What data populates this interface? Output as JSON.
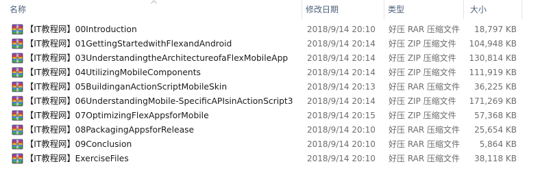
{
  "columns": {
    "name": "名称",
    "date_modified": "修改日期",
    "type": "类型",
    "size": "大小"
  },
  "files": [
    {
      "name": "【IT教程网】00Introduction",
      "date_modified": "2018/9/14 20:10",
      "type": "好压 RAR 压缩文件",
      "size": "18,797 KB",
      "icon": "rar-archive-icon"
    },
    {
      "name": "【IT教程网】01GettingStartedwithFlexandAndroid",
      "date_modified": "2018/9/14 20:14",
      "type": "好压 ZIP 压缩文件",
      "size": "104,948 KB",
      "icon": "zip-archive-icon"
    },
    {
      "name": "【IT教程网】03UnderstandingtheArchitectureofaFlexMobileApp",
      "date_modified": "2018/9/14 20:14",
      "type": "好压 ZIP 压缩文件",
      "size": "130,814 KB",
      "icon": "zip-archive-icon"
    },
    {
      "name": "【IT教程网】04UtilizingMobileComponents",
      "date_modified": "2018/9/14 20:14",
      "type": "好压 ZIP 压缩文件",
      "size": "111,919 KB",
      "icon": "zip-archive-icon"
    },
    {
      "name": "【IT教程网】05BuildinganActionScriptMobileSkin",
      "date_modified": "2018/9/14 20:13",
      "type": "好压 RAR 压缩文件",
      "size": "36,225 KB",
      "icon": "rar-archive-icon"
    },
    {
      "name": "【IT教程网】06UnderstandingMobile-SpecificAPIsinActionScript3",
      "date_modified": "2018/9/14 20:14",
      "type": "好压 ZIP 压缩文件",
      "size": "171,269 KB",
      "icon": "zip-archive-icon"
    },
    {
      "name": "【IT教程网】07OptimizingFlexAppsforMobile",
      "date_modified": "2018/9/14 20:15",
      "type": "好压 ZIP 压缩文件",
      "size": "57,368 KB",
      "icon": "zip-archive-icon"
    },
    {
      "name": "【IT教程网】08PackagingAppsforRelease",
      "date_modified": "2018/9/14 20:10",
      "type": "好压 RAR 压缩文件",
      "size": "25,654 KB",
      "icon": "rar-archive-icon"
    },
    {
      "name": "【IT教程网】09Conclusion",
      "date_modified": "2018/9/14 20:10",
      "type": "好压 RAR 压缩文件",
      "size": "5,864 KB",
      "icon": "rar-archive-icon"
    },
    {
      "name": "【IT教程网】ExerciseFiles",
      "date_modified": "2018/9/14 20:10",
      "type": "好压 RAR 压缩文件",
      "size": "38,118 KB",
      "icon": "rar-archive-icon"
    }
  ],
  "colors": {
    "header_text": "#4c607a",
    "secondary_text": "#6d6d6d",
    "divider": "#e5e5e5"
  }
}
